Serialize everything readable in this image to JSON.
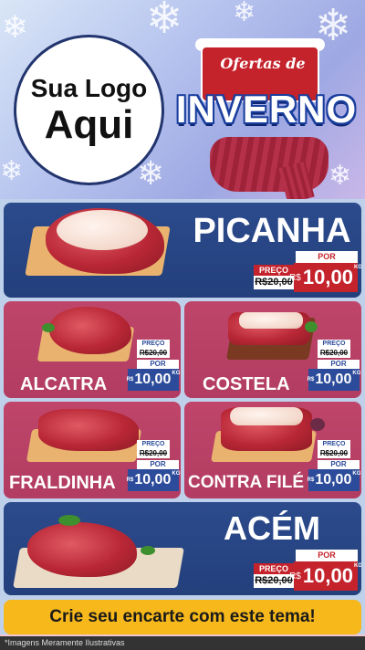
{
  "header": {
    "logo_line1": "Sua Logo",
    "logo_line2": "Aqui",
    "campaign_top": "Ofertas de",
    "campaign_title": "INVERNO"
  },
  "products": [
    {
      "name": "PICANHA",
      "old_label": "PREÇO",
      "old_price": "R$20,00",
      "new_label": "POR",
      "currency": "R$",
      "price": "10,00",
      "unit": "KG"
    },
    {
      "name": "ALCATRA",
      "old_label": "PREÇO",
      "old_price": "R$20,00",
      "new_label": "POR",
      "currency": "R$",
      "price": "10,00",
      "unit": "KG"
    },
    {
      "name": "COSTELA",
      "old_label": "PREÇO",
      "old_price": "R$20,00",
      "new_label": "POR",
      "currency": "R$",
      "price": "10,00",
      "unit": "KG"
    },
    {
      "name": "FRALDINHA",
      "old_label": "PREÇO",
      "old_price": "R$20,00",
      "new_label": "POR",
      "currency": "R$",
      "price": "10,00",
      "unit": "KG"
    },
    {
      "name": "CONTRA FILÉ",
      "old_label": "PREÇO",
      "old_price": "R$20,00",
      "new_label": "POR",
      "currency": "R$",
      "price": "10,00",
      "unit": "KG"
    },
    {
      "name": "ACÉM",
      "old_label": "PREÇO",
      "old_price": "R$20,00",
      "new_label": "POR",
      "currency": "R$",
      "price": "10,00",
      "unit": "KG"
    }
  ],
  "cta": "Crie seu encarte com este tema!",
  "footer": "*Imagens Meramente Ilustrativas",
  "colors": {
    "blue_panel": "#2c4b8c",
    "pink_panel": "#bf456a",
    "price_red": "#c4232c",
    "price_blue": "#2c4b9b",
    "cta_yellow": "#f6b81b"
  }
}
